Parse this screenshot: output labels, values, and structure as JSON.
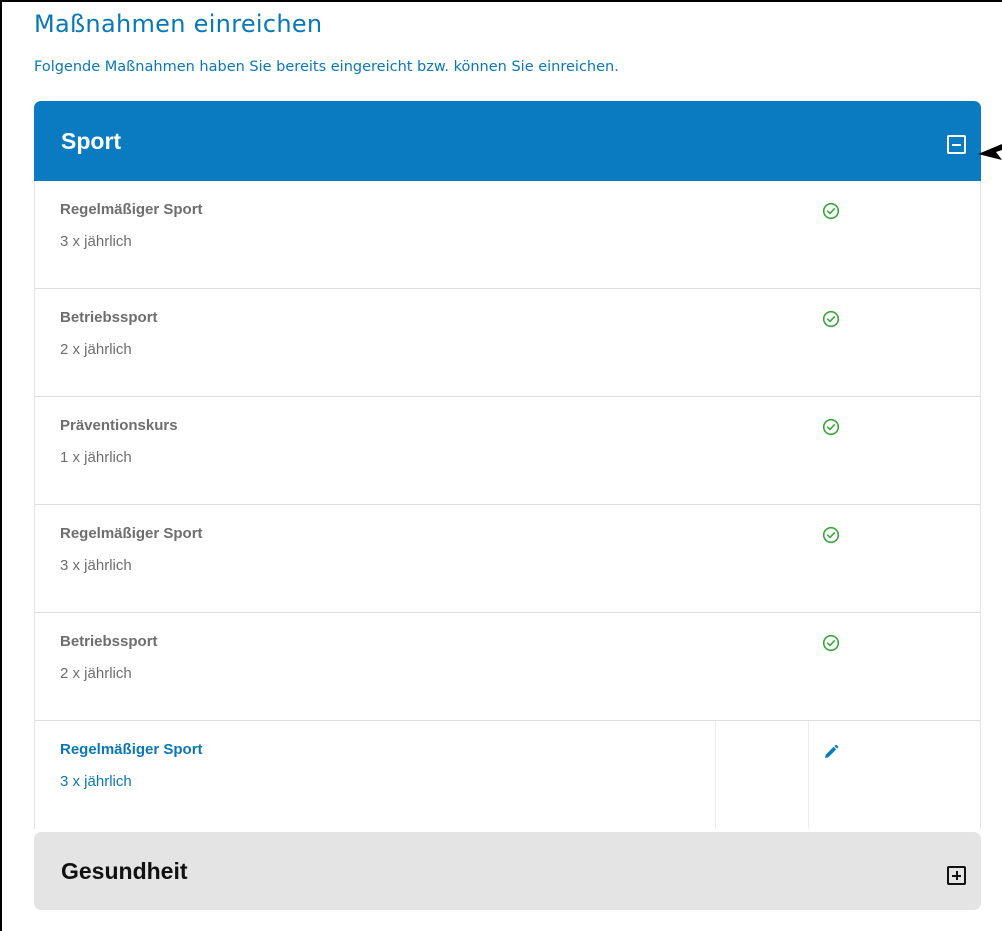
{
  "page": {
    "title": "Maßnahmen einreichen",
    "subtitle": "Folgende Maßnahmen haben Sie bereits eingereicht bzw. können Sie einreichen."
  },
  "sections": [
    {
      "title": "Sport",
      "expanded": true,
      "toggle_icon": "minus-square-icon",
      "items": [
        {
          "name": "Regelmäßiger Sport",
          "frequency": "3 x jährlich",
          "status_icon": "check-circle-icon"
        },
        {
          "name": "Betriebssport",
          "frequency": "2 x jährlich",
          "status_icon": "check-circle-icon"
        },
        {
          "name": "Präventionskurs",
          "frequency": "1 x jährlich",
          "status_icon": "check-circle-icon"
        },
        {
          "name": "Regelmäßiger Sport",
          "frequency": "3 x jährlich",
          "status_icon": "check-circle-icon"
        },
        {
          "name": "Betriebssport",
          "frequency": "2 x jährlich",
          "status_icon": "check-circle-icon"
        },
        {
          "name": "Regelmäßiger Sport",
          "frequency": "3 x jährlich",
          "status_icon": "pencil-icon"
        }
      ]
    },
    {
      "title": "Gesundheit",
      "expanded": false,
      "toggle_icon": "plus-square-icon"
    }
  ],
  "colors": {
    "accent_blue": "#0a7bc1",
    "text_blue": "#0a77b7",
    "check_green": "#3aa63a",
    "muted_text": "#6e6e6e",
    "collapsed_header": "#e4e4e4"
  }
}
